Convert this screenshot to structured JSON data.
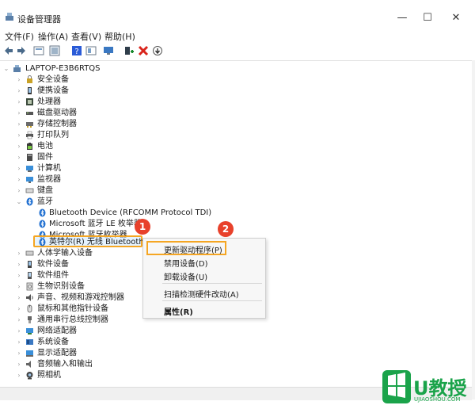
{
  "window": {
    "title": "设备管理器",
    "controls": {
      "minimize": "—",
      "maximize": "☐",
      "close": "✕"
    }
  },
  "menubar": {
    "items": [
      "文件(F)",
      "操作(A)",
      "查看(V)",
      "帮助(H)"
    ]
  },
  "toolbar": {
    "icons": [
      "back-icon",
      "forward-icon",
      "properties-icon",
      "show-hidden-icon",
      "help-icon",
      "view-icon",
      "monitor-icon",
      "add-driver-icon",
      "uninstall-icon",
      "download-icon"
    ],
    "colors": {
      "uninstall": "#d9251c",
      "add": "#1a8a2e",
      "help": "#2a5bd7"
    }
  },
  "tree": {
    "root": "LAPTOP-E3B6RTQS",
    "categories": [
      "安全设备",
      "便携设备",
      "处理器",
      "磁盘驱动器",
      "存储控制器",
      "打印队列",
      "电池",
      "固件",
      "计算机",
      "监视器",
      "键盘",
      "蓝牙"
    ],
    "bluetooth_children": [
      "Bluetooth Device (RFCOMM Protocol TDI)",
      "Microsoft 蓝牙 LE 枚举器",
      "Microsoft 蓝牙枚举器",
      "英特尔(R) 无线 Bluetooth(R)"
    ],
    "categories_after": [
      "人体学输入设备",
      "软件设备",
      "软件组件",
      "生物识别设备",
      "声音、视频和游戏控制器",
      "鼠标和其他指针设备",
      "通用串行总线控制器",
      "网络适配器",
      "系统设备",
      "显示适配器",
      "音频输入和输出",
      "照相机"
    ]
  },
  "context_menu": {
    "items": [
      "更新驱动程序(P)",
      "禁用设备(D)",
      "卸载设备(U)",
      "扫描检测硬件改动(A)",
      "属性(R)"
    ]
  },
  "annotations": {
    "step1": "1",
    "step2": "2",
    "highlight_color": "#f5a623",
    "badge_color": "#e8412b"
  },
  "watermark": {
    "text": "U教授",
    "sub": "UJIAOSHOU.COM",
    "color": "#1aa34a"
  }
}
